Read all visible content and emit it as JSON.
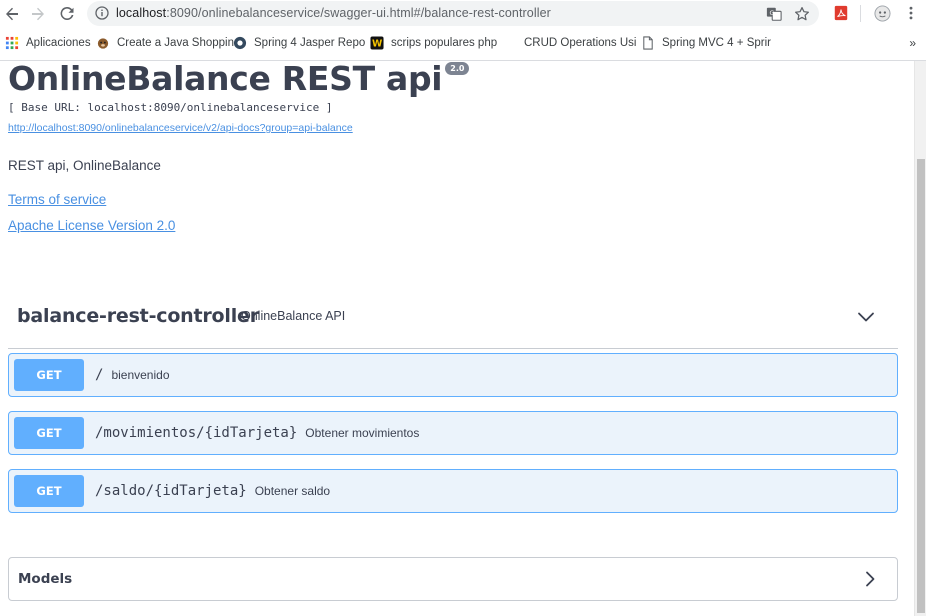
{
  "browser": {
    "url_host": "localhost",
    "url_rest": ":8090/onlinebalanceservice/swagger-ui.html#/balance-rest-controller",
    "bookmarks": [
      {
        "label": "Aplicaciones",
        "icon": "apps-grid-icon"
      },
      {
        "label": "Create a Java Shoppin",
        "icon": "dog-favicon-icon"
      },
      {
        "label": "Spring 4 Jasper Repo",
        "icon": "circle-favicon-icon"
      },
      {
        "label": "scrips populares php",
        "icon": "w-favicon-icon"
      },
      {
        "label": "CRUD Operations Usi",
        "icon": "blank-favicon-icon"
      },
      {
        "label": "Spring MVC 4 + Sprir",
        "icon": "page-icon"
      }
    ],
    "bookmarks_more": "»"
  },
  "info": {
    "title": "OnlineBalance REST api",
    "version": "2.0",
    "base_url": "[ Base URL: localhost:8090/onlinebalanceservice ]",
    "docs_link": "http://localhost:8090/onlinebalanceservice/v2/api-docs?group=api-balance",
    "description": "REST api, OnlineBalance",
    "terms": "Terms of service",
    "license": "Apache License Version 2.0"
  },
  "tag": {
    "name": "balance-rest-controller",
    "description": "OnlineBalance API"
  },
  "operations": [
    {
      "method": "GET",
      "path": "/",
      "summary": "bienvenido"
    },
    {
      "method": "GET",
      "path": "/movimientos/{idTarjeta}",
      "summary": "Obtener movimientos"
    },
    {
      "method": "GET",
      "path": "/saldo/{idTarjeta}",
      "summary": "Obtener saldo"
    }
  ],
  "models": {
    "title": "Models"
  },
  "colors": {
    "get_method": "#61affe",
    "get_background": "#ebf3fb",
    "link": "#4990e2",
    "text": "#3b4151"
  }
}
